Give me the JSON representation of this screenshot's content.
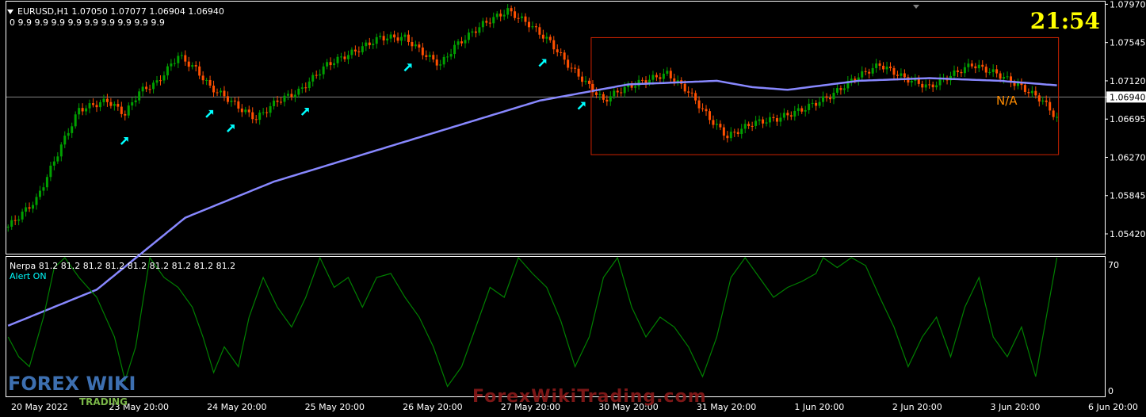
{
  "header": {
    "symbol_line": "EURUSD,H1  1.07050 1.07077 1.06904 1.06940",
    "ma_line": "0 9.9 9.9 9.9 9.9 9.9 9.9 9.9 9.9 9.9"
  },
  "clock": "21:54",
  "na_label": "N/A",
  "indicator": {
    "title": "Nerpa 81.2 81.2 81.2 81.2 81.2 81.2 81.2 81.2 81.2",
    "alert": "Alert ON",
    "y_labels": [
      "70",
      "0"
    ]
  },
  "watermark": "ForexWikiTrading.com",
  "logo": {
    "brand": "FOREX WIKI",
    "sub": "TRADING"
  },
  "colors": {
    "bull": "#00a000",
    "bear": "#ff5000",
    "ma": "#8888ff",
    "oscillator": "#008000",
    "arrow": "#00ffff",
    "box": "#cc2200",
    "current_price_line": "#808080"
  },
  "chart_data": [
    {
      "type": "candlestick",
      "symbol": "EURUSD",
      "timeframe": "H1",
      "ylim": [
        1.052,
        1.08
      ],
      "yticks": [
        1.0797,
        1.07545,
        1.0712,
        1.0694,
        1.06695,
        1.0627,
        1.05845,
        1.0542
      ],
      "current_price": 1.0694,
      "xticks": [
        "20 May 2022",
        "23 May 20:00",
        "24 May 20:00",
        "25 May 20:00",
        "26 May 20:00",
        "27 May 20:00",
        "30 May 20:00",
        "31 May 20:00",
        "1 Jun 20:00",
        "2 Jun 20:00",
        "3 Jun 20:00",
        "6 Jun 20:00"
      ],
      "close_path": [
        [
          0,
          1.055
        ],
        [
          8,
          1.058
        ],
        [
          15,
          1.064
        ],
        [
          20,
          1.068
        ],
        [
          28,
          1.069
        ],
        [
          33,
          1.0675
        ],
        [
          37,
          1.07
        ],
        [
          42,
          1.071
        ],
        [
          48,
          1.074
        ],
        [
          53,
          1.0725
        ],
        [
          57,
          1.0705
        ],
        [
          61,
          1.0695
        ],
        [
          66,
          1.068
        ],
        [
          70,
          1.067
        ],
        [
          76,
          1.069
        ],
        [
          82,
          1.07
        ],
        [
          90,
          1.073
        ],
        [
          98,
          1.0745
        ],
        [
          105,
          1.076
        ],
        [
          112,
          1.076
        ],
        [
          118,
          1.074
        ],
        [
          122,
          1.073
        ],
        [
          126,
          1.075
        ],
        [
          134,
          1.0775
        ],
        [
          141,
          1.079
        ],
        [
          147,
          1.0775
        ],
        [
          153,
          1.0755
        ],
        [
          158,
          1.073
        ],
        [
          163,
          1.071
        ],
        [
          168,
          1.069
        ],
        [
          172,
          1.07
        ],
        [
          178,
          1.071
        ],
        [
          186,
          1.072
        ],
        [
          192,
          1.07
        ],
        [
          198,
          1.067
        ],
        [
          203,
          1.065
        ],
        [
          210,
          1.0665
        ],
        [
          217,
          1.067
        ],
        [
          224,
          1.068
        ],
        [
          232,
          1.0695
        ],
        [
          239,
          1.0715
        ],
        [
          246,
          1.073
        ],
        [
          253,
          1.0715
        ],
        [
          260,
          1.0705
        ],
        [
          266,
          1.0718
        ],
        [
          272,
          1.073
        ],
        [
          279,
          1.072
        ],
        [
          286,
          1.0705
        ],
        [
          292,
          1.069
        ],
        [
          296,
          1.067
        ]
      ],
      "ma_path": [
        [
          0,
          1.044
        ],
        [
          25,
          1.048
        ],
        [
          50,
          1.056
        ],
        [
          75,
          1.06
        ],
        [
          100,
          1.063
        ],
        [
          125,
          1.066
        ],
        [
          150,
          1.069
        ],
        [
          175,
          1.0708
        ],
        [
          200,
          1.0712
        ],
        [
          210,
          1.0705
        ],
        [
          220,
          1.0702
        ],
        [
          240,
          1.0712
        ],
        [
          260,
          1.0715
        ],
        [
          280,
          1.0712
        ],
        [
          296,
          1.0707
        ]
      ],
      "signal_arrow_bars": [
        33,
        57,
        63,
        84,
        113,
        151,
        162
      ],
      "box_bars": [
        165,
        296
      ],
      "box_price_range": [
        1.063,
        1.076
      ]
    },
    {
      "type": "line",
      "name": "Nerpa",
      "ylim": [
        0,
        70
      ],
      "yticks": [
        70,
        0
      ],
      "points": [
        [
          0,
          30
        ],
        [
          3,
          20
        ],
        [
          6,
          15
        ],
        [
          10,
          40
        ],
        [
          13,
          65
        ],
        [
          16,
          70
        ],
        [
          20,
          60
        ],
        [
          25,
          50
        ],
        [
          30,
          30
        ],
        [
          33,
          8
        ],
        [
          36,
          25
        ],
        [
          40,
          70
        ],
        [
          44,
          60
        ],
        [
          48,
          55
        ],
        [
          52,
          45
        ],
        [
          55,
          30
        ],
        [
          58,
          12
        ],
        [
          61,
          25
        ],
        [
          65,
          15
        ],
        [
          68,
          40
        ],
        [
          72,
          60
        ],
        [
          76,
          45
        ],
        [
          80,
          35
        ],
        [
          84,
          50
        ],
        [
          88,
          70
        ],
        [
          92,
          55
        ],
        [
          96,
          60
        ],
        [
          100,
          45
        ],
        [
          104,
          60
        ],
        [
          108,
          62
        ],
        [
          112,
          50
        ],
        [
          116,
          40
        ],
        [
          120,
          25
        ],
        [
          124,
          5
        ],
        [
          128,
          15
        ],
        [
          132,
          35
        ],
        [
          136,
          55
        ],
        [
          140,
          50
        ],
        [
          144,
          70
        ],
        [
          148,
          62
        ],
        [
          152,
          55
        ],
        [
          156,
          38
        ],
        [
          160,
          15
        ],
        [
          164,
          30
        ],
        [
          168,
          60
        ],
        [
          172,
          70
        ],
        [
          176,
          45
        ],
        [
          180,
          30
        ],
        [
          184,
          40
        ],
        [
          188,
          35
        ],
        [
          192,
          25
        ],
        [
          196,
          10
        ],
        [
          200,
          30
        ],
        [
          204,
          60
        ],
        [
          208,
          70
        ],
        [
          212,
          60
        ],
        [
          216,
          50
        ],
        [
          220,
          55
        ],
        [
          224,
          58
        ],
        [
          228,
          62
        ],
        [
          230,
          70
        ],
        [
          234,
          65
        ],
        [
          238,
          70
        ],
        [
          242,
          66
        ],
        [
          246,
          50
        ],
        [
          250,
          35
        ],
        [
          254,
          15
        ],
        [
          258,
          30
        ],
        [
          262,
          40
        ],
        [
          266,
          20
        ],
        [
          270,
          45
        ],
        [
          274,
          60
        ],
        [
          278,
          30
        ],
        [
          282,
          20
        ],
        [
          286,
          35
        ],
        [
          290,
          10
        ],
        [
          293,
          40
        ],
        [
          296,
          70
        ]
      ]
    }
  ]
}
